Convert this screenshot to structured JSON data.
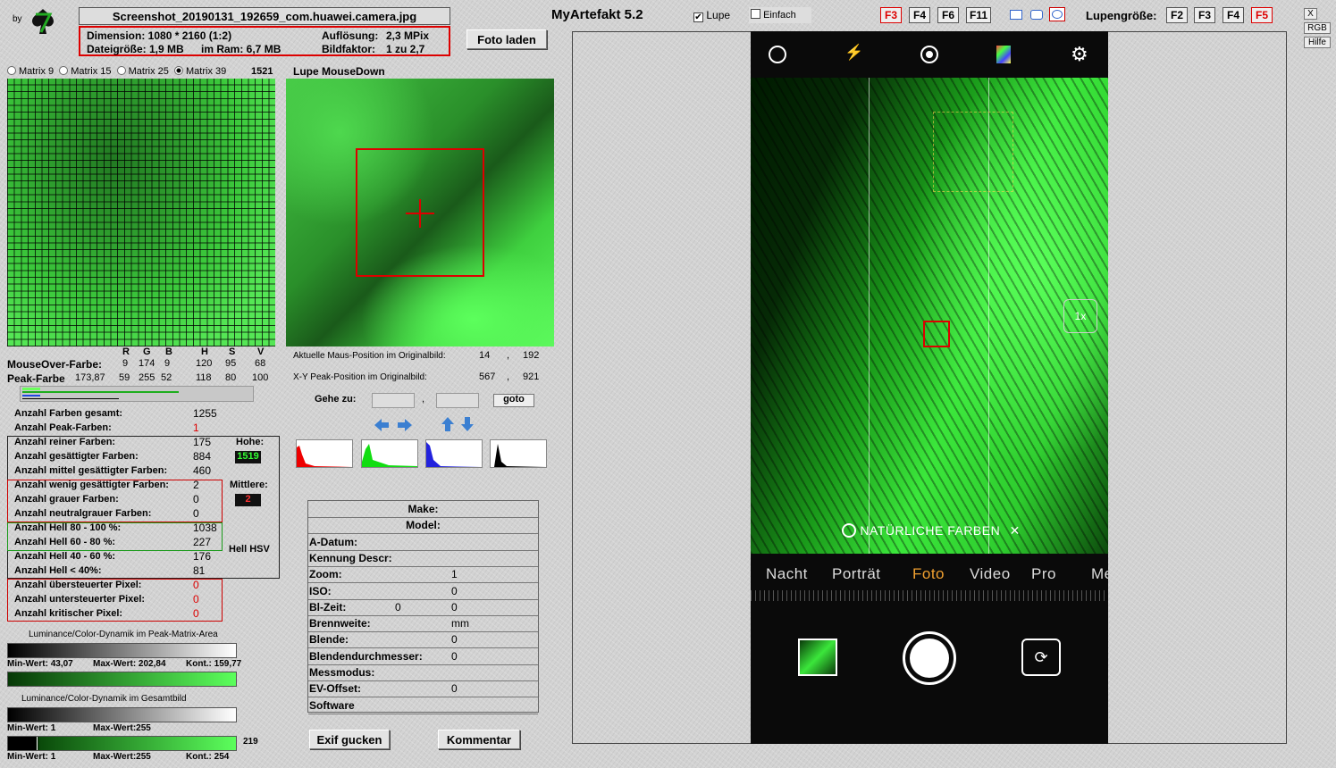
{
  "logo": {
    "by_label": "by"
  },
  "app": {
    "title": "MyArtefakt 5.2"
  },
  "file": {
    "name": "Screenshot_20190131_192659_com.huawei.camera.jpg",
    "dimension_label": "Dimension: 1080 * 2160 (1:2)",
    "resolution_label": "Auflösung:",
    "resolution_value": "2,3 MPix",
    "filesize_label": "Dateigröße: 1,9 MB",
    "ram_label": "im Ram: 6,7 MB",
    "factor_label": "Bildfaktor:",
    "factor_value": "1 zu 2,7"
  },
  "toolbar": {
    "load_photo": "Foto laden",
    "lupe_label": "Lupe",
    "lupe_checked": true,
    "einfach_label": "Einfach",
    "einfach_checked": false,
    "fkeys": [
      "F3",
      "F4",
      "F6",
      "F11"
    ],
    "lupe_size_label": "Lupengröße:",
    "size_keys": [
      "F2",
      "F3",
      "F4",
      "F5"
    ],
    "active_fkey": "F3",
    "active_size": "F5"
  },
  "side_buttons": {
    "close": "X",
    "rgb": "RGB",
    "help": "Hilfe"
  },
  "matrix": {
    "options": [
      "Matrix 9",
      "Matrix 15",
      "Matrix 25",
      "Matrix 39"
    ],
    "selected": "Matrix 39",
    "count": "1521"
  },
  "lupe": {
    "title": "Lupe MouseDown",
    "mouse_pos_label": "Aktuelle Maus-Position  im Originalbild:",
    "mouse_x": "14",
    "mouse_y": "192",
    "peak_pos_label": "X-Y Peak-Position  im Originalbild:",
    "peak_x": "567",
    "peak_y": "921",
    "goto_label": "Gehe zu:",
    "goto_button": "goto",
    "separator": ","
  },
  "colors": {
    "headers": [
      "R",
      "G",
      "B",
      "H",
      "S",
      "V"
    ],
    "mouseover_label": "MouseOver-Farbe:",
    "mouseover": [
      "9",
      "174",
      "9",
      "120",
      "95",
      "68"
    ],
    "peak_label": "Peak-Farbe",
    "peak_extra": "173,87",
    "peak": [
      "59",
      "255",
      "52",
      "118",
      "80",
      "100"
    ]
  },
  "stats": [
    {
      "label": "Anzahl Farben gesamt:",
      "value": "1255"
    },
    {
      "label": "Anzahl Peak-Farben:",
      "value": "1"
    },
    {
      "label": "Anzahl reiner Farben:",
      "value": "175"
    },
    {
      "label": "Anzahl gesättigter Farben:",
      "value": "884"
    },
    {
      "label": "Anzahl mittel gesättigter Farben:",
      "value": "460"
    },
    {
      "label": "Anzahl wenig gesättigter Farben:",
      "value": "2"
    },
    {
      "label": "Anzahl grauer Farben:",
      "value": "0"
    },
    {
      "label": "Anzahl neutralgrauer Farben:",
      "value": "0"
    },
    {
      "label": "Anzahl Hell 80 - 100 %:",
      "value": "1038"
    },
    {
      "label": "Anzahl Hell 60 - 80 %:",
      "value": "227"
    },
    {
      "label": "Anzahl Hell 40 - 60 %:",
      "value": "176"
    },
    {
      "label": "Anzahl Hell < 40%:",
      "value": "81"
    },
    {
      "label": "Anzahl übersteuerter Pixel:",
      "value": "0"
    },
    {
      "label": "Anzahl untersteuerter Pixel:",
      "value": "0"
    },
    {
      "label": "Anzahl kritischer Pixel:",
      "value": "0"
    }
  ],
  "side_stats": {
    "hohe_label": "Hohe:",
    "hohe_value": "1519",
    "mittlere_label": "Mittlere:",
    "mittlere_value": "2",
    "hell_label": "Hell HSV"
  },
  "dynamics": {
    "peak_title": "Luminance/Color-Dynamik im Peak-Matrix-Area",
    "peak_min": "Min-Wert: 43,07",
    "peak_max": "Max-Wert: 202,84",
    "peak_kont": "Kont.: 159,77",
    "total_title": "Luminance/Color-Dynamik im Gesamtbild",
    "total_min": "Min-Wert: 1",
    "total_max": "Max-Wert:255",
    "total_min2": "Min-Wert: 1",
    "total_max2": "Max-Wert:255",
    "total_kont": "Kont.: 254",
    "total_side": "219"
  },
  "exif": {
    "rows": [
      {
        "label": "Make:",
        "v1": "",
        "v2": ""
      },
      {
        "label": "Model:",
        "v1": "",
        "v2": ""
      },
      {
        "label": "A-Datum:",
        "v1": "",
        "v2": ""
      },
      {
        "label": "Kennung Descr:",
        "v1": "",
        "v2": ""
      },
      {
        "label": "Zoom:",
        "v1": "",
        "v2": "1"
      },
      {
        "label": "ISO:",
        "v1": "",
        "v2": "0"
      },
      {
        "label": "Bl-Zeit:",
        "v1": "0",
        "v2": "0"
      },
      {
        "label": "Brennweite:",
        "v1": "",
        "v2": "mm"
      },
      {
        "label": "Blende:",
        "v1": "",
        "v2": "0"
      },
      {
        "label": "Blendendurchmesser:",
        "v1": "",
        "v2": "0"
      },
      {
        "label": "Messmodus:",
        "v1": "",
        "v2": ""
      },
      {
        "label": "EV-Offset:",
        "v1": "",
        "v2": "0"
      },
      {
        "label": "Software",
        "v1": "",
        "v2": ""
      }
    ],
    "exif_button": "Exif gucken",
    "comment_button": "Kommentar"
  },
  "phone": {
    "banner": "NATÜRLICHE FARBEN",
    "zoom_label": "1x",
    "modes": [
      "Nacht",
      "Porträt",
      "Foto",
      "Video",
      "Pro",
      "Meh"
    ],
    "active_mode": "Foto"
  }
}
